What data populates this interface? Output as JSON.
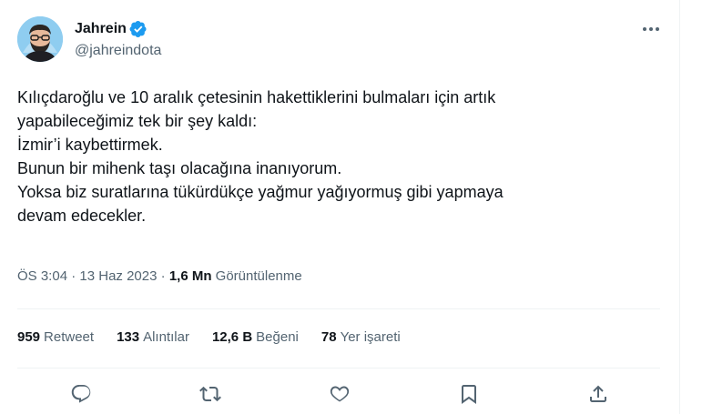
{
  "author": {
    "name": "Jahrein",
    "handle": "@jahreindota"
  },
  "tweet": {
    "lines": [
      "Kılıçdaroğlu ve 10 aralık çetesinin hakettiklerini bulmaları için artık",
      "yapabileceğimiz tek bir şey kaldı:",
      "İzmir’i kaybettirmek.",
      "Bunun bir mihenk taşı olacağına inanıyorum.",
      "Yoksa biz suratlarına tükürdükçe yağmur yağıyormuş gibi yapmaya",
      "devam edecekler."
    ]
  },
  "meta": {
    "time": "ÖS 3:04",
    "date": "13 Haz 2023",
    "separator": "·",
    "views_count": "1,6 Mn",
    "views_label": "Görüntülenme"
  },
  "stats": {
    "retweets": {
      "count": "959",
      "label": "Retweet"
    },
    "quotes": {
      "count": "133",
      "label": "Alıntılar"
    },
    "likes": {
      "count": "12,6 B",
      "label": "Beğeni"
    },
    "bookmarks": {
      "count": "78",
      "label": "Yer işareti"
    }
  },
  "colors": {
    "text": "#0f1419",
    "secondary": "#536471",
    "verified": "#1d9bf0",
    "divider": "#eff3f4"
  },
  "icons": [
    "verified-badge-icon",
    "more-icon",
    "reply-icon",
    "retweet-icon",
    "like-icon",
    "bookmark-icon",
    "share-icon"
  ]
}
